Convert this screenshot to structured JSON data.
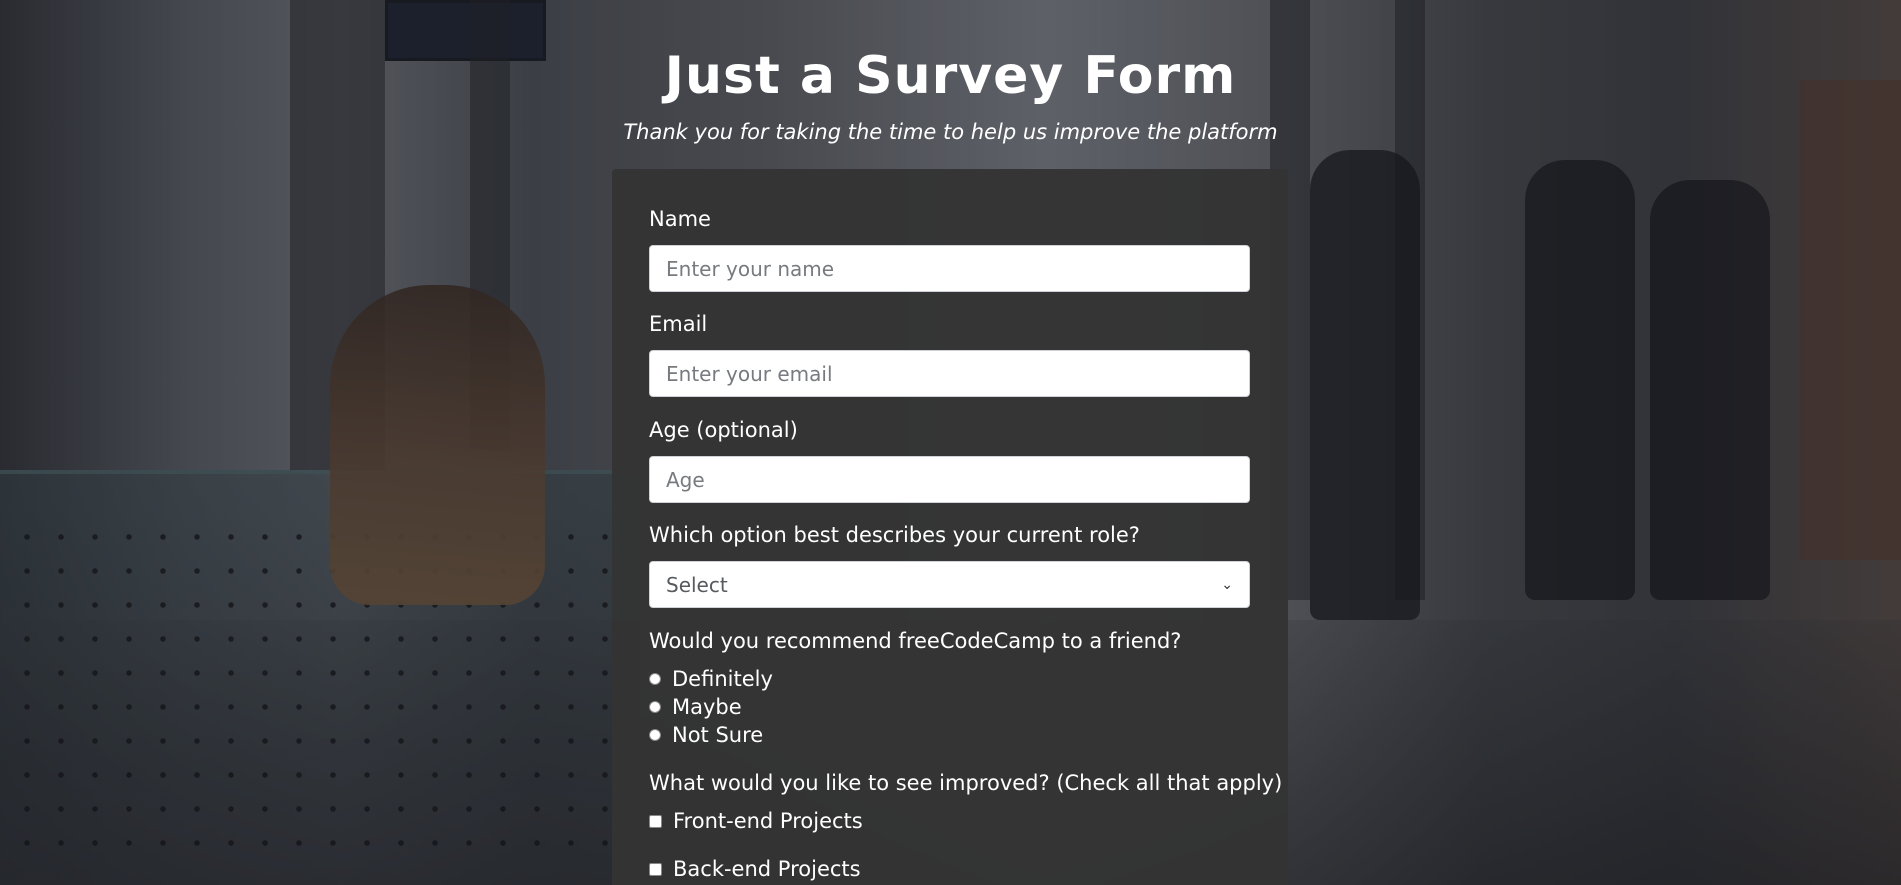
{
  "header": {
    "title": "Just a Survey Form",
    "description": "Thank you for taking the time to help us improve the platform"
  },
  "form": {
    "name": {
      "label": "Name",
      "placeholder": "Enter your name",
      "value": ""
    },
    "email": {
      "label": "Email",
      "placeholder": "Enter your email",
      "value": ""
    },
    "age": {
      "label": "Age (optional)",
      "placeholder": "Age",
      "value": ""
    },
    "role": {
      "label": "Which option best describes your current role?",
      "selected": "Select"
    },
    "recommend": {
      "label": "Would you recommend freeCodeCamp to a friend?",
      "options": [
        "Definitely",
        "Maybe",
        "Not Sure"
      ]
    },
    "improve": {
      "label": "What would you like to see improved? (Check all that apply)",
      "options": [
        "Front-end Projects",
        "Back-end Projects"
      ]
    }
  },
  "colors": {
    "card": "#343434",
    "text": "#ffffff"
  }
}
